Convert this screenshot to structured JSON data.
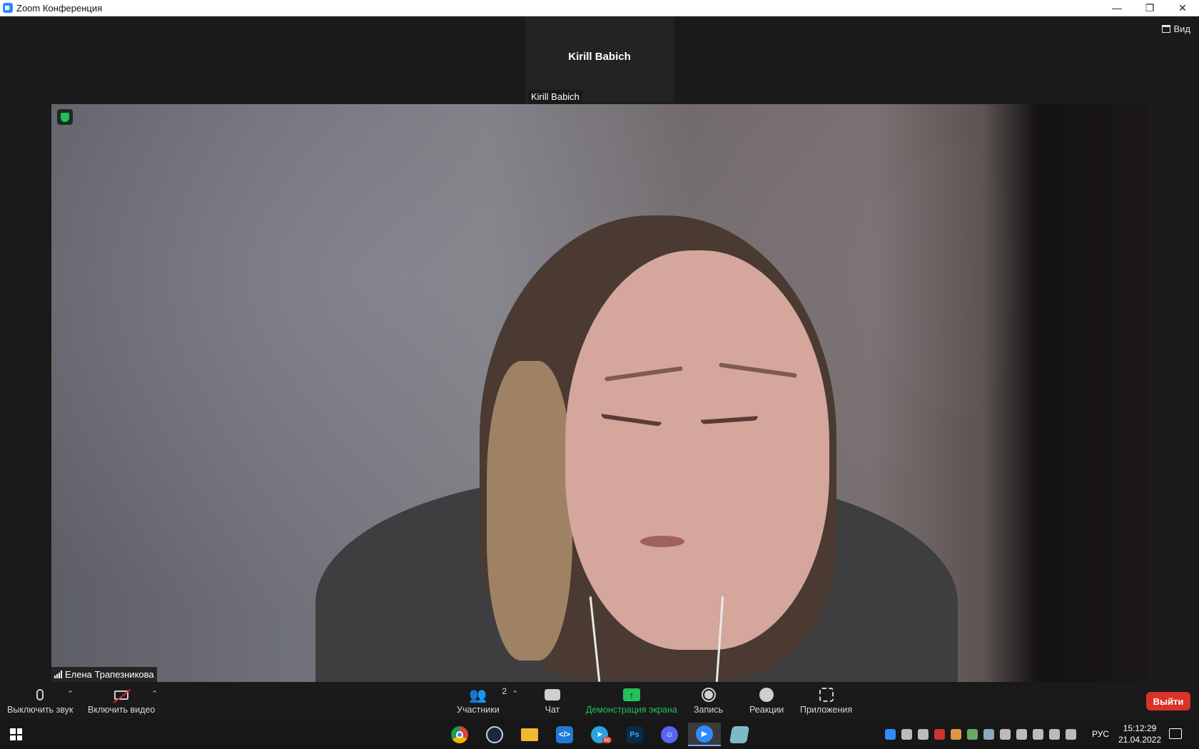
{
  "window": {
    "title": "Zoom Конференция",
    "minimize": "—",
    "restore": "❐",
    "close": "✕"
  },
  "view_button": {
    "label": "Вид"
  },
  "thumbnail": {
    "center_name": "Kirill Babich",
    "label": "Kirill Babich"
  },
  "main_video": {
    "participant_name": "Елена Трапезникова"
  },
  "toolbar": {
    "mute_label": "Выключить звук",
    "video_label": "Включить видео",
    "participants_label": "Участники",
    "participants_count": "2",
    "chat_label": "Чат",
    "share_label": "Демонстрация экрана",
    "record_label": "Запись",
    "reactions_label": "Реакции",
    "apps_label": "Приложения",
    "leave_label": "Выйти",
    "caret": "⌃"
  },
  "taskbar": {
    "apps": [
      {
        "name": "chrome",
        "glyph": "",
        "color": "#db4437"
      },
      {
        "name": "steam",
        "glyph": "",
        "color": "#1b2838"
      },
      {
        "name": "file-explorer",
        "glyph": "",
        "color": "#f2b632"
      },
      {
        "name": "vscode",
        "glyph": "",
        "color": "#1f7ad6"
      },
      {
        "name": "telegram",
        "glyph": "",
        "color": "#2aa3df"
      },
      {
        "name": "photoshop",
        "glyph": "Ps",
        "color": "#0b2a44"
      },
      {
        "name": "discord",
        "glyph": "",
        "color": "#5865f2"
      },
      {
        "name": "zoom",
        "glyph": "",
        "color": "#2d8cff"
      },
      {
        "name": "notepad",
        "glyph": "",
        "color": "#7fb9c9"
      }
    ],
    "telegram_badge": "66",
    "language": "РУС",
    "time": "15:12:29",
    "date": "21.04.2022"
  },
  "colors": {
    "accent_green": "#21c05b",
    "leave_red": "#d9322b",
    "zoom_blue": "#2d8cff"
  }
}
